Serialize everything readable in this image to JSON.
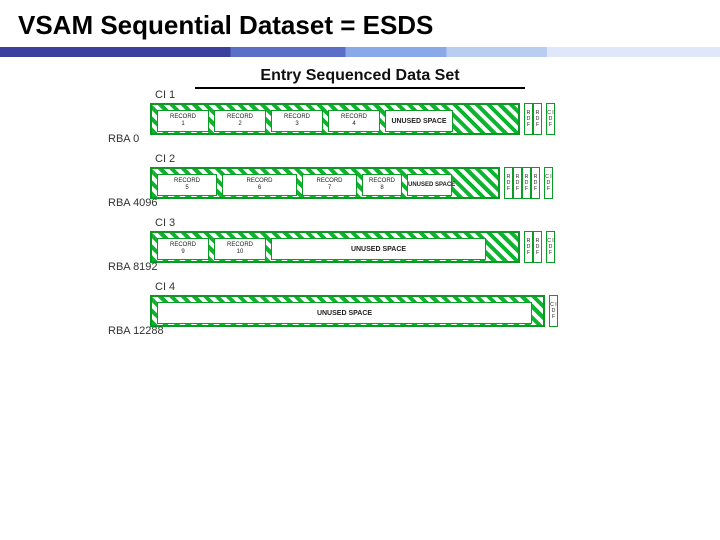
{
  "slide": {
    "title": "VSAM Sequential Dataset   = ESDS"
  },
  "figure": {
    "title": "Entry Sequenced Data Set",
    "ci_labels": [
      "CI 1",
      "CI 2",
      "CI 3",
      "CI 4"
    ],
    "rba_labels": [
      "RBA  0",
      "RBA  4096",
      "RBA  8192",
      "RBA  12288"
    ],
    "rdf": "R D F",
    "cidf": "C I D F",
    "ci1": {
      "r1a": "RECORD",
      "r1b": "1",
      "r2a": "RECORD",
      "r2b": "2",
      "r3a": "RECORD",
      "r3b": "3",
      "r4a": "RECORD",
      "r4b": "4",
      "unused": "UNUSED SPACE"
    },
    "ci2": {
      "r1a": "RECORD",
      "r1b": "5",
      "r2a": "RECORD",
      "r2b": "6",
      "r3a": "RECORD",
      "r3b": "7",
      "r4a": "RECORD",
      "r4b": "8",
      "unused": "UNUSED SPACE"
    },
    "ci3": {
      "r1a": "RECORD",
      "r1b": "9",
      "r2a": "RECORD",
      "r2b": "10",
      "unused": "UNUSED SPACE"
    },
    "ci4": {
      "unused": "UNUSED SPACE"
    }
  }
}
